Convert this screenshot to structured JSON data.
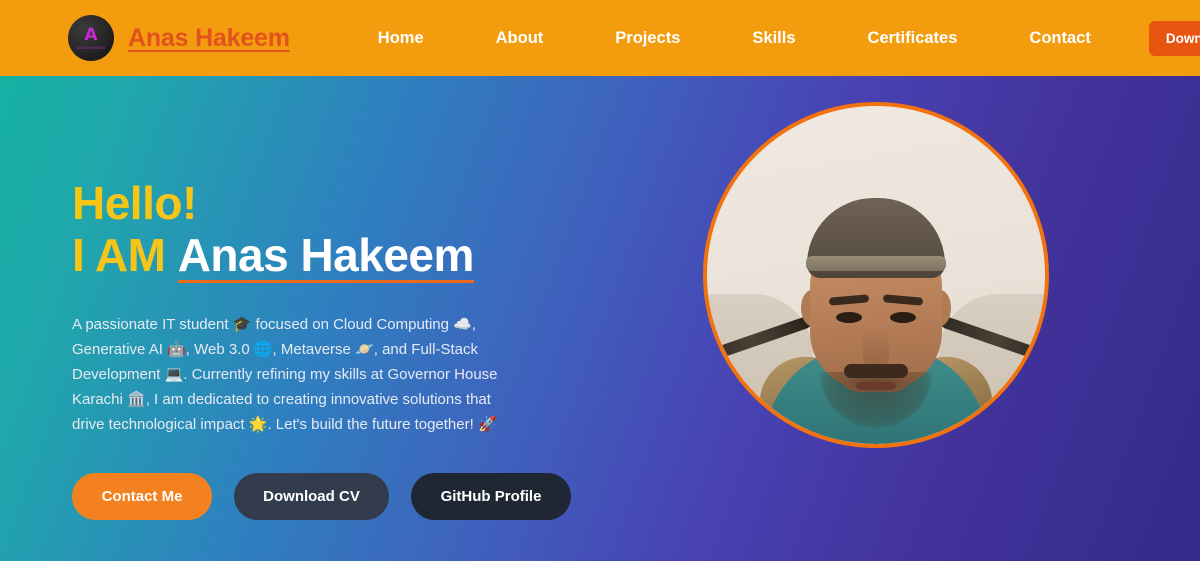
{
  "colors": {
    "navbar_bg": "#f39c0e",
    "brand_text": "#e2521c",
    "nav_cv_button": "#e85511",
    "hero_gradient_start": "#16b2a4",
    "hero_gradient_end": "#332a8b",
    "accent_yellow": "#f5c518",
    "accent_orange": "#f2720e",
    "contact_button": "#f4811f",
    "cv_button": "#333c4d",
    "github_button": "#1f2634"
  },
  "navbar": {
    "logo_mark": "A",
    "logo_sub": "ANAS HAKEEM",
    "brand_name": "Anas Hakeem",
    "links": [
      {
        "label": "Home"
      },
      {
        "label": "About"
      },
      {
        "label": "Projects"
      },
      {
        "label": "Skills"
      },
      {
        "label": "Certificates"
      },
      {
        "label": "Contact"
      }
    ],
    "cv_button_label": "Download CV"
  },
  "hero": {
    "greeting": "Hello!",
    "iam": "I AM",
    "name": "Anas Hakeem",
    "description_parts": {
      "p1": "A passionate IT student ",
      "e1": "🎓",
      "p2": " focused on Cloud Computing ",
      "e2": "☁️",
      "p3": ", Generative AI ",
      "e3": "🤖",
      "p4": ", Web 3.0 ",
      "e4": "🌐",
      "p5": ", Metaverse ",
      "e5": "🪐",
      "p6": ", and Full-Stack Development ",
      "e6": "💻",
      "p7": ". Currently refining my skills at Governor House Karachi ",
      "e7": "🏛️",
      "p8": ", I am dedicated to creating innovative solutions that drive technological impact ",
      "e8": "🌟",
      "p9": ". Let's build the future together! ",
      "e9": "🚀"
    },
    "buttons": {
      "contact": "Contact Me",
      "download_cv": "Download CV",
      "github": "GitHub Profile"
    },
    "avatar_alt": "Anas Hakeem profile photo"
  }
}
